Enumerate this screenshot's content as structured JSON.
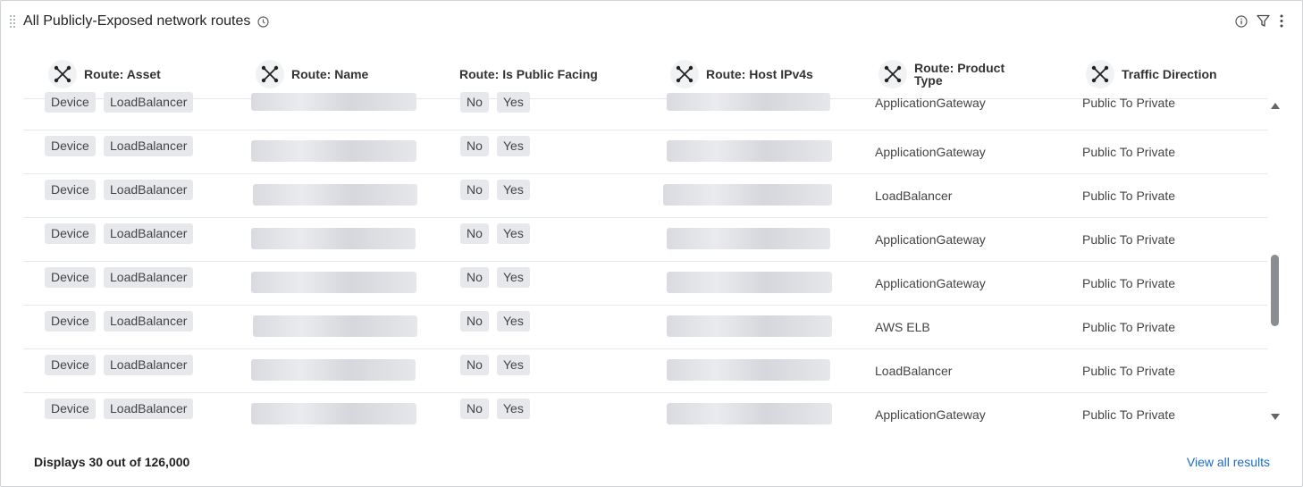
{
  "widget": {
    "title": "All Publicly-Exposed network routes"
  },
  "columns": [
    {
      "label": "Route: Asset",
      "has_icon": true
    },
    {
      "label": "Route: Name",
      "has_icon": true
    },
    {
      "label": "Route: Is Public Facing",
      "has_icon": false
    },
    {
      "label": "Route: Host IPv4s",
      "has_icon": true
    },
    {
      "label": "Route: Product Type",
      "has_icon": true
    },
    {
      "label": "Traffic Direction",
      "has_icon": true
    }
  ],
  "rows": [
    {
      "asset_tags": [
        "Device",
        "LoadBalancer"
      ],
      "public_tags": [
        "No",
        "Yes"
      ],
      "product_type": "ApplicationGateway",
      "direction": "Public To Private"
    },
    {
      "asset_tags": [
        "Device",
        "LoadBalancer"
      ],
      "public_tags": [
        "No",
        "Yes"
      ],
      "product_type": "ApplicationGateway",
      "direction": "Public To Private"
    },
    {
      "asset_tags": [
        "Device",
        "LoadBalancer"
      ],
      "public_tags": [
        "No",
        "Yes"
      ],
      "product_type": "LoadBalancer",
      "direction": "Public To Private"
    },
    {
      "asset_tags": [
        "Device",
        "LoadBalancer"
      ],
      "public_tags": [
        "No",
        "Yes"
      ],
      "product_type": "ApplicationGateway",
      "direction": "Public To Private"
    },
    {
      "asset_tags": [
        "Device",
        "LoadBalancer"
      ],
      "public_tags": [
        "No",
        "Yes"
      ],
      "product_type": "ApplicationGateway",
      "direction": "Public To Private"
    },
    {
      "asset_tags": [
        "Device",
        "LoadBalancer"
      ],
      "public_tags": [
        "No",
        "Yes"
      ],
      "product_type": "AWS ELB",
      "direction": "Public To Private"
    },
    {
      "asset_tags": [
        "Device",
        "LoadBalancer"
      ],
      "public_tags": [
        "No",
        "Yes"
      ],
      "product_type": "LoadBalancer",
      "direction": "Public To Private"
    },
    {
      "asset_tags": [
        "Device",
        "LoadBalancer"
      ],
      "public_tags": [
        "No",
        "Yes"
      ],
      "product_type": "ApplicationGateway",
      "direction": "Public To Private"
    }
  ],
  "footer": {
    "count_text": "Displays 30 out of 126,000",
    "view_all_label": "View all results"
  },
  "icons": {
    "drag": "drag-handle-icon",
    "history": "clock-icon",
    "info": "info-icon",
    "filter": "filter-icon",
    "menu": "kebab-menu-icon",
    "column": "route-node-icon"
  },
  "colors": {
    "link": "#1a6bc6",
    "tag_bg": "#e6e8ec",
    "border": "#cfd3d8"
  }
}
